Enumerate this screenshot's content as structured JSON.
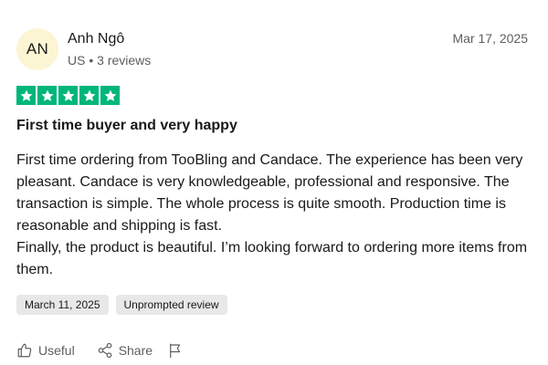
{
  "reviewer": {
    "initials": "AN",
    "name": "Anh Ngô",
    "meta": "US • 3 reviews"
  },
  "review": {
    "date": "Mar 17, 2025",
    "rating": 5,
    "rating_max": 5,
    "star_color": "#00b67a",
    "title": "First time buyer and very happy",
    "body_lines": [
      "First time ordering from TooBling and Candace. The experience has been very pleasant. Candace is very knowledgeable, professional and responsive. The transaction is simple. The whole process is quite smooth. Production time is reasonable and shipping is fast.",
      "Finally, the product is beautiful. I’m looking forward to ordering more items from them."
    ],
    "tags": [
      "March 11, 2025",
      "Unprompted review"
    ]
  },
  "actions": {
    "useful_label": "Useful",
    "share_label": "Share",
    "icons": [
      "thumbs-up-icon",
      "share-icon",
      "flag-icon"
    ]
  }
}
